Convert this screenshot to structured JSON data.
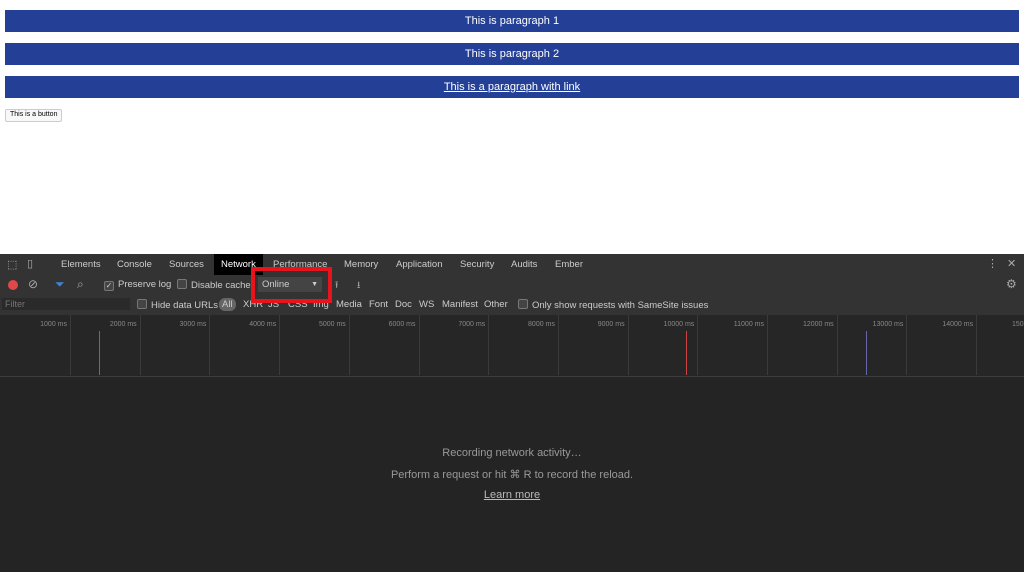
{
  "page": {
    "paragraphs": [
      "This is paragraph 1",
      "This is paragraph 2"
    ],
    "link_paragraph": "This is a paragraph with link",
    "button": "This is a button",
    "paragraph_color": "#233f96"
  },
  "devtools": {
    "tabs": [
      "Elements",
      "Console",
      "Sources",
      "Network",
      "Performance",
      "Memory",
      "Application",
      "Security",
      "Audits",
      "Ember"
    ],
    "active_tab": "Network",
    "toolbar": {
      "preserve_log": "Preserve log",
      "preserve_log_checked": true,
      "disable_cache": "Disable cache",
      "disable_cache_checked": false,
      "throttling": "Online"
    },
    "filter": {
      "placeholder": "Filter",
      "hide_data_urls": "Hide data URLs",
      "types": [
        "All",
        "XHR",
        "JS",
        "CSS",
        "Img",
        "Media",
        "Font",
        "Doc",
        "WS",
        "Manifest",
        "Other"
      ],
      "samesite": "Only show requests with SameSite issues"
    },
    "timeline": {
      "ticks": [
        "1000 ms",
        "2000 ms",
        "3000 ms",
        "4000 ms",
        "5000 ms",
        "6000 ms",
        "7000 ms",
        "8000 ms",
        "9000 ms",
        "10000 ms",
        "11000 ms",
        "12000 ms",
        "13000 ms",
        "14000 ms",
        "150"
      ]
    },
    "empty": {
      "recording": "Recording network activity…",
      "hint": "Perform a request or hit ⌘ R to record the reload.",
      "learn_more": "Learn more"
    },
    "highlight_color": "#e8141b"
  }
}
